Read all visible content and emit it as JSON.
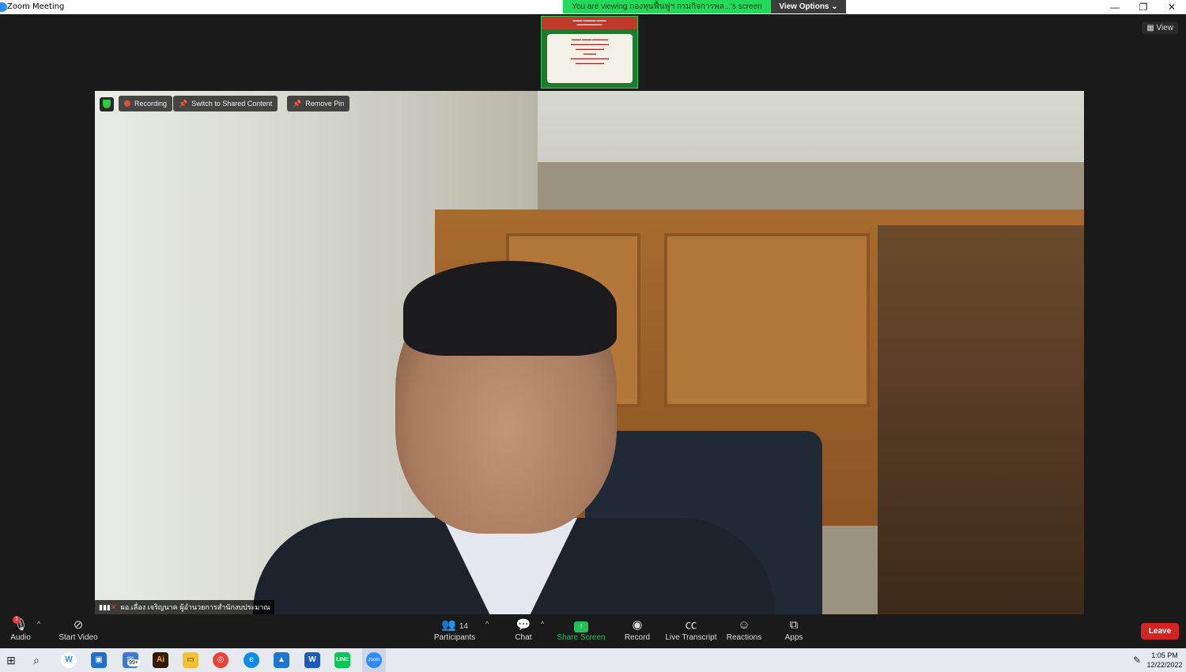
{
  "window": {
    "title": "Zoom Meeting"
  },
  "banner": {
    "text": "You are viewing กองทุนฟื้นฟูฯ กรมกิจการพล...'s screen",
    "view_options": "View Options ⌄"
  },
  "stage": {
    "view_label": "View"
  },
  "video": {
    "recording": "Recording",
    "switch_label": "Switch to Shared Content",
    "remove_pin": "Remove Pin",
    "name": "ผอ.เลื่อง เจริญนาค ผู้อำนวยการสำนักงบประมาณ"
  },
  "toolbar": {
    "audio": "Audio",
    "video": "Start Video",
    "participants": "Participants",
    "participants_count": "14",
    "chat": "Chat",
    "share": "Share Screen",
    "record": "Record",
    "transcript": "Live Transcript",
    "reactions": "Reactions",
    "apps": "Apps",
    "leave": "Leave",
    "audio_badge": "1"
  },
  "taskbar": {
    "time": "1:05 PM",
    "date": "12/22/2022",
    "mail_badge": "99+"
  },
  "colors": {
    "accent": "#2D8CFF",
    "banner": "#23d959",
    "leave": "#d32424",
    "share": "#1ec15a"
  }
}
